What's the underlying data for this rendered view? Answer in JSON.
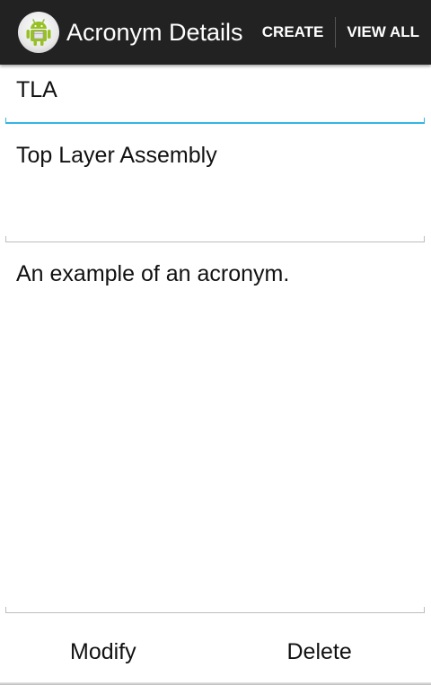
{
  "action_bar": {
    "title": "Acronym Details",
    "icon": "android-app-icon",
    "actions": [
      {
        "label": "CREATE"
      },
      {
        "label": "VIEW ALL"
      }
    ]
  },
  "form": {
    "acronym": "TLA",
    "meaning": "Top Layer Assembly",
    "description": "An example of an acronym."
  },
  "buttons": {
    "modify": "Modify",
    "delete": "Delete"
  },
  "colors": {
    "action_bar_bg": "#222222",
    "focus_underline": "#33b5e5",
    "inactive_underline": "#bdbdbd"
  }
}
